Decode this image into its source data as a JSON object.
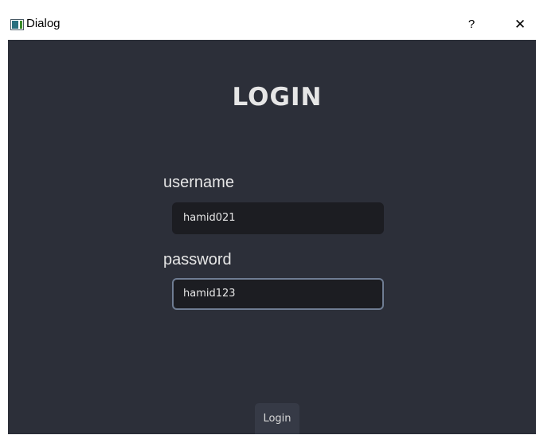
{
  "window": {
    "title": "Dialog",
    "help_label": "?",
    "close_label": "✕"
  },
  "form": {
    "heading": "LOGIN",
    "username_label": "username",
    "username_value": "hamid021",
    "password_label": "password",
    "password_value": "hamid123",
    "login_button": "Login"
  },
  "colors": {
    "background": "#2c2f39",
    "input_background": "#1c1d22",
    "focus_border": "#6f7d93",
    "text": "#e6e6e6"
  }
}
